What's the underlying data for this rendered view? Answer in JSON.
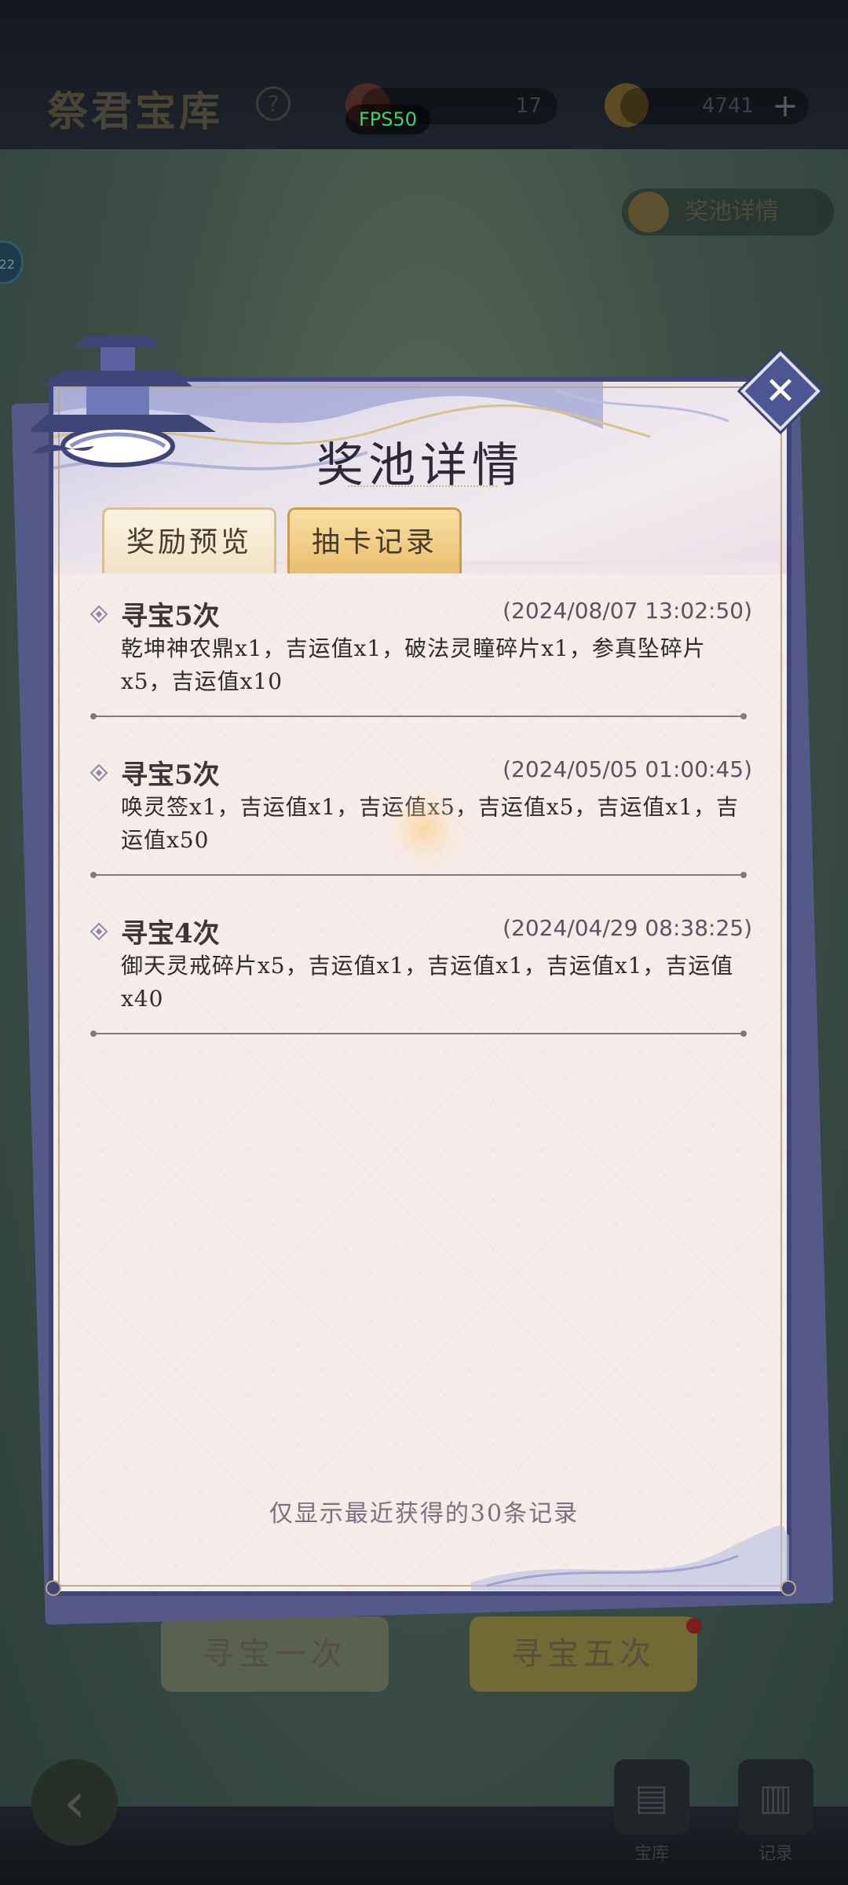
{
  "background": {
    "title": "祭君宝库",
    "help_icon": "question-icon",
    "resource1_value": "17",
    "resource2_value": "4741",
    "detail_button_label": "奖池详情",
    "badge_value": "22",
    "draw_once_label": "寻宝一次",
    "draw_five_label": "寻宝五次",
    "icon1_label": "宝库",
    "icon2_label": "记录"
  },
  "fps_label": "FPS50",
  "modal": {
    "title": "奖池详情",
    "tabs": [
      {
        "label": "奖励预览",
        "active": false
      },
      {
        "label": "抽卡记录",
        "active": true
      }
    ],
    "records": [
      {
        "title": "寻宝5次",
        "time": "(2024/08/07  13:02:50)",
        "items": "乾坤神农鼎x1，吉运值x1，破法灵瞳碎片x1，参真坠碎片x5，吉运值x10"
      },
      {
        "title": "寻宝5次",
        "time": "(2024/05/05  01:00:45)",
        "items": "唤灵签x1，吉运值x1，吉运值x5，吉运值x5，吉运值x1，吉运值x50"
      },
      {
        "title": "寻宝4次",
        "time": "(2024/04/29  08:38:25)",
        "items": "御天灵戒碎片x5，吉运值x1，吉运值x1，吉运值x1，吉运值x40"
      }
    ],
    "footer_note": "仅显示最近获得的30条记录",
    "close_icon": "close-icon"
  },
  "colors": {
    "modal_border": "#3f4677",
    "active_tab": "#ebbd70",
    "fps_text": "#38d66e"
  }
}
